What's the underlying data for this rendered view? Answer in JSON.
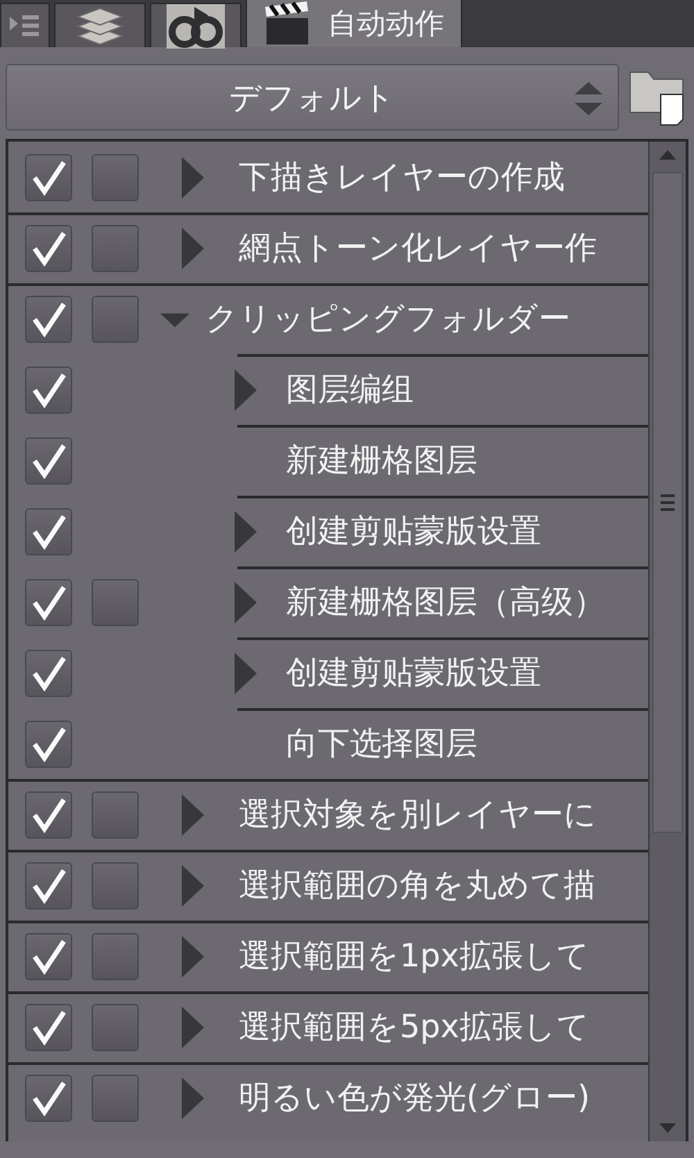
{
  "tabs": [
    {
      "selected": false
    },
    {
      "selected": false
    },
    {
      "selected": false
    },
    {
      "label": "自动动作",
      "selected": true
    }
  ],
  "action_set": {
    "value": "デフォルト"
  },
  "actions": [
    {
      "name": "下描きレイヤーの作成",
      "checked": true,
      "dialog": true,
      "kind": "set",
      "expanded": false
    },
    {
      "name": "網点トーン化レイヤー作",
      "checked": true,
      "dialog": true,
      "kind": "set",
      "expanded": false
    },
    {
      "name": "クリッピングフォルダー",
      "checked": true,
      "dialog": true,
      "kind": "set",
      "expanded": true,
      "children": [
        {
          "name": "图层编组",
          "checked": true,
          "dialog": false,
          "kind": "set",
          "expanded": false
        },
        {
          "name": "新建栅格图层",
          "checked": true,
          "dialog": false,
          "kind": "step"
        },
        {
          "name": "创建剪贴蒙版设置",
          "checked": true,
          "dialog": false,
          "kind": "set",
          "expanded": false
        },
        {
          "name": "新建栅格图层（高级）",
          "checked": true,
          "dialog": true,
          "kind": "set",
          "expanded": false
        },
        {
          "name": "创建剪贴蒙版设置",
          "checked": true,
          "dialog": false,
          "kind": "set",
          "expanded": false
        },
        {
          "name": "向下选择图层",
          "checked": true,
          "dialog": false,
          "kind": "step"
        }
      ]
    },
    {
      "name": "選択対象を別レイヤーに",
      "checked": true,
      "dialog": true,
      "kind": "set",
      "expanded": false
    },
    {
      "name": "選択範囲の角を丸めて描",
      "checked": true,
      "dialog": true,
      "kind": "set",
      "expanded": false
    },
    {
      "name": "選択範囲を1px拡張して",
      "checked": true,
      "dialog": true,
      "kind": "set",
      "expanded": false
    },
    {
      "name": "選択範囲を5px拡張して",
      "checked": true,
      "dialog": true,
      "kind": "set",
      "expanded": false
    },
    {
      "name": "明るい色が発光(グロー)",
      "checked": true,
      "dialog": true,
      "kind": "set",
      "expanded": false
    }
  ]
}
